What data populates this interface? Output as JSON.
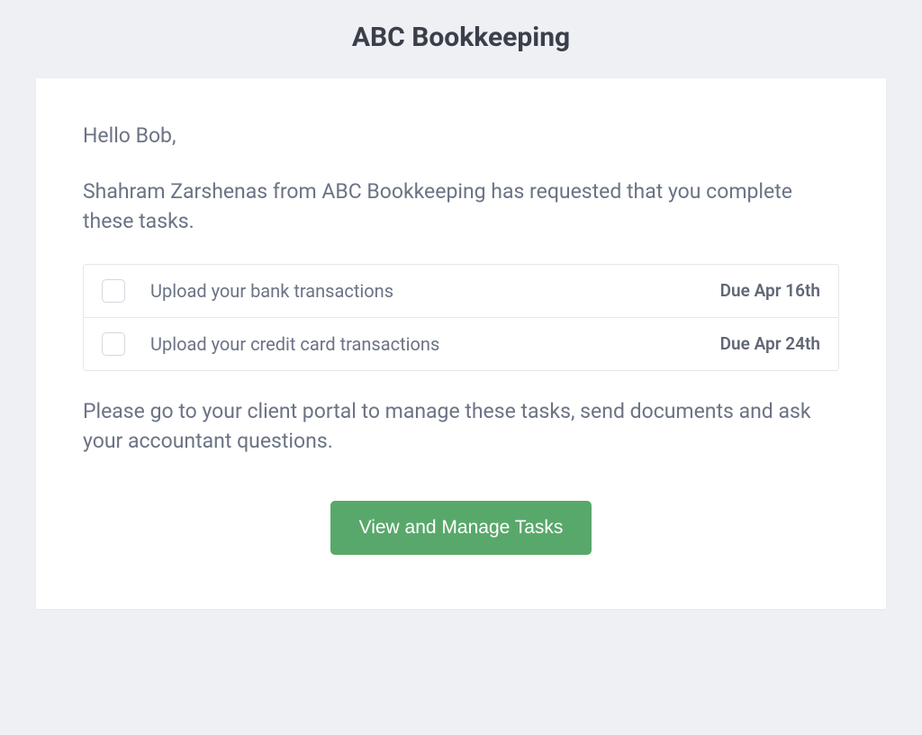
{
  "header": {
    "title": "ABC Bookkeeping"
  },
  "body": {
    "greeting": "Hello Bob,",
    "intro": "Shahram Zarshenas from ABC Bookkeeping has requested that you complete these tasks.",
    "tasks": [
      {
        "title": "Upload your bank transactions",
        "due": "Due Apr 16th"
      },
      {
        "title": "Upload your credit card transactions",
        "due": "Due Apr 24th"
      }
    ],
    "instructions": "Please go to your client portal to manage these tasks, send documents and ask your accountant questions.",
    "cta_label": "View and Manage Tasks"
  }
}
